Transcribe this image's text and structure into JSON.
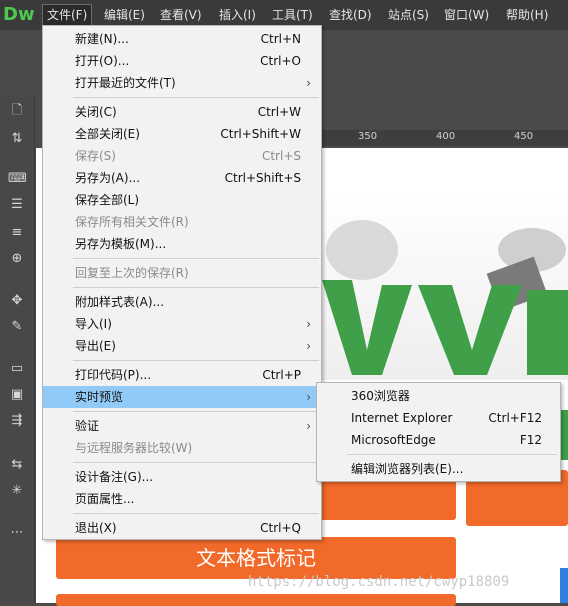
{
  "app": {
    "logo": "Dw"
  },
  "menubar": {
    "items": [
      "文件(F)",
      "编辑(E)",
      "查看(V)",
      "插入(I)",
      "工具(T)",
      "查找(D)",
      "站点(S)",
      "窗口(W)",
      "帮助(H)"
    ]
  },
  "ruler": {
    "ticks": [
      "350",
      "400",
      "450"
    ]
  },
  "file_menu": {
    "items": [
      {
        "label": "新建(N)...",
        "shortcut": "Ctrl+N"
      },
      {
        "label": "打开(O)...",
        "shortcut": "Ctrl+O"
      },
      {
        "label": "打开最近的文件(T)",
        "shortcut": ""
      },
      {
        "label": "关闭(C)",
        "shortcut": "Ctrl+W"
      },
      {
        "label": "全部关闭(E)",
        "shortcut": "Ctrl+Shift+W"
      },
      {
        "label": "保存(S)",
        "shortcut": "Ctrl+S"
      },
      {
        "label": "另存为(A)...",
        "shortcut": "Ctrl+Shift+S"
      },
      {
        "label": "保存全部(L)",
        "shortcut": ""
      },
      {
        "label": "保存所有相关文件(R)",
        "shortcut": ""
      },
      {
        "label": "另存为模板(M)...",
        "shortcut": ""
      },
      {
        "label": "回复至上次的保存(R)",
        "shortcut": ""
      },
      {
        "label": "附加样式表(A)...",
        "shortcut": ""
      },
      {
        "label": "导入(I)",
        "shortcut": ""
      },
      {
        "label": "导出(E)",
        "shortcut": ""
      },
      {
        "label": "打印代码(P)...",
        "shortcut": "Ctrl+P"
      },
      {
        "label": "实时预览",
        "shortcut": ""
      },
      {
        "label": "验证",
        "shortcut": ""
      },
      {
        "label": "与远程服务器比较(W)",
        "shortcut": ""
      },
      {
        "label": "设计备注(G)...",
        "shortcut": ""
      },
      {
        "label": "页面属性...",
        "shortcut": ""
      },
      {
        "label": "退出(X)",
        "shortcut": "Ctrl+Q"
      }
    ]
  },
  "preview_submenu": {
    "items": [
      {
        "label": "360浏览器",
        "shortcut": ""
      },
      {
        "label": "Internet Explorer",
        "shortcut": "Ctrl+F12"
      },
      {
        "label": "MicrosoftEdge",
        "shortcut": "F12"
      },
      {
        "label": "编辑浏览器列表(E)...",
        "shortcut": ""
      }
    ]
  },
  "canvas": {
    "button_text": "文本格式标记",
    "watermark": "https://blog.csdn.net/cwyp18809"
  },
  "colors": {
    "accent_orange": "#f26a2a",
    "highlight": "#91c9f7",
    "green": "#3fa049"
  }
}
